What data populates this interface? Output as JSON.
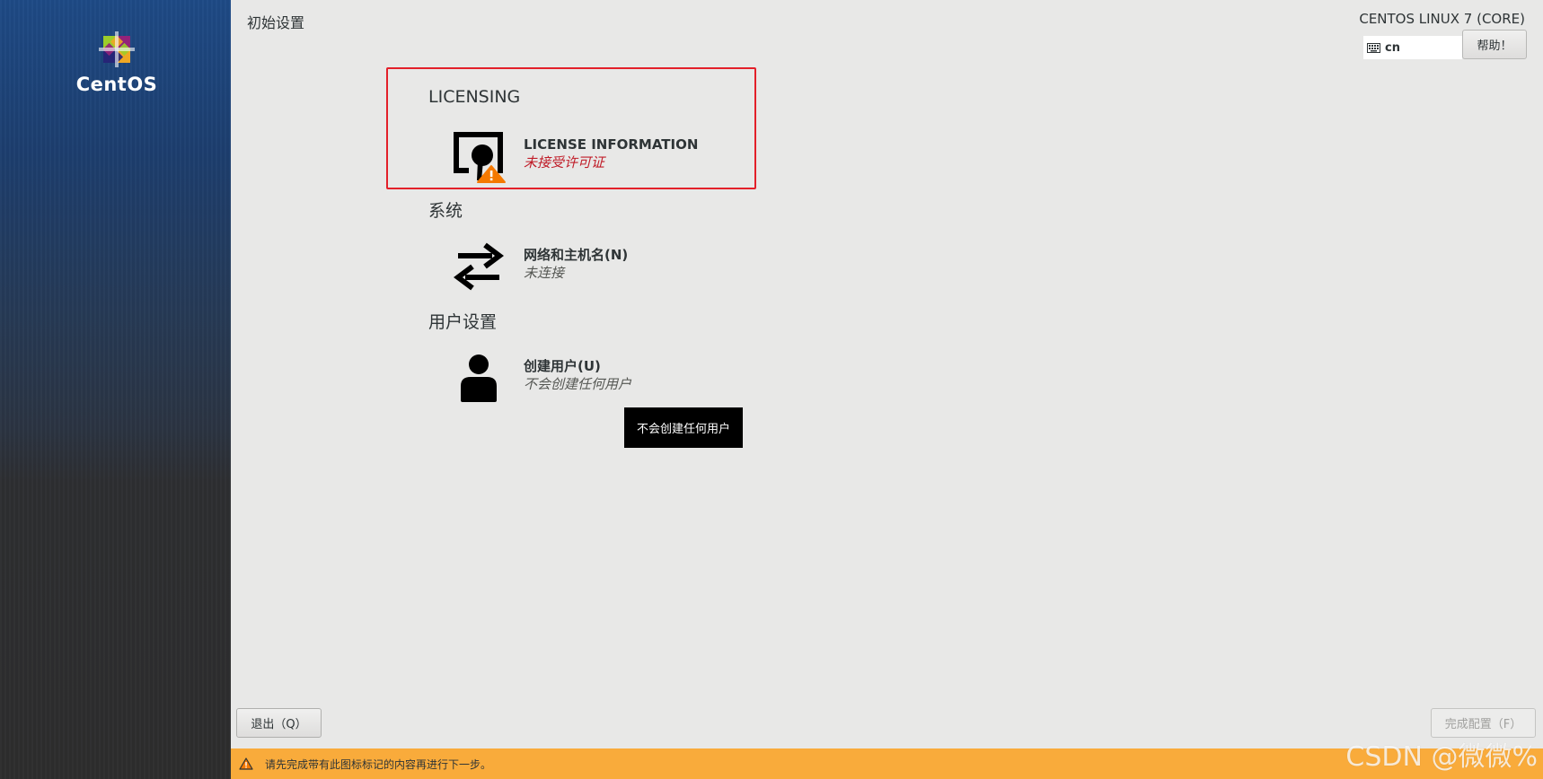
{
  "sidebar": {
    "logo_text": "CentOS"
  },
  "header": {
    "page_title": "初始设置",
    "product_title": "CENTOS LINUX 7 (CORE)",
    "keyboard_layout": "cn",
    "help_label": "帮助！"
  },
  "sections": [
    {
      "title": "LICENSING",
      "spokes": [
        {
          "title": "LICENSE INFORMATION",
          "status": "未接受许可证",
          "icon": "license-warning-icon"
        }
      ]
    },
    {
      "title": "系统",
      "spokes": [
        {
          "title": "网络和主机名(N)",
          "status": "未连接",
          "icon": "network-arrows-icon"
        }
      ]
    },
    {
      "title": "用户设置",
      "spokes": [
        {
          "title": "创建用户(U)",
          "status": "不会创建任何用户",
          "icon": "user-icon"
        }
      ]
    }
  ],
  "tooltip": "不会创建任何用户",
  "footer": {
    "quit_label": "退出（Q）",
    "finish_label": "完成配置（F）",
    "warning_text": "请先完成带有此图标标记的内容再进行下一步。"
  },
  "watermark": "CSDN @微微%",
  "colors": {
    "sidebar_top": "#1e4a86",
    "sidebar_bottom": "#2d2d2d",
    "warning_bar": "#f9ab3b",
    "highlight_border": "#e3202a",
    "status_warning": "#c01c28"
  }
}
